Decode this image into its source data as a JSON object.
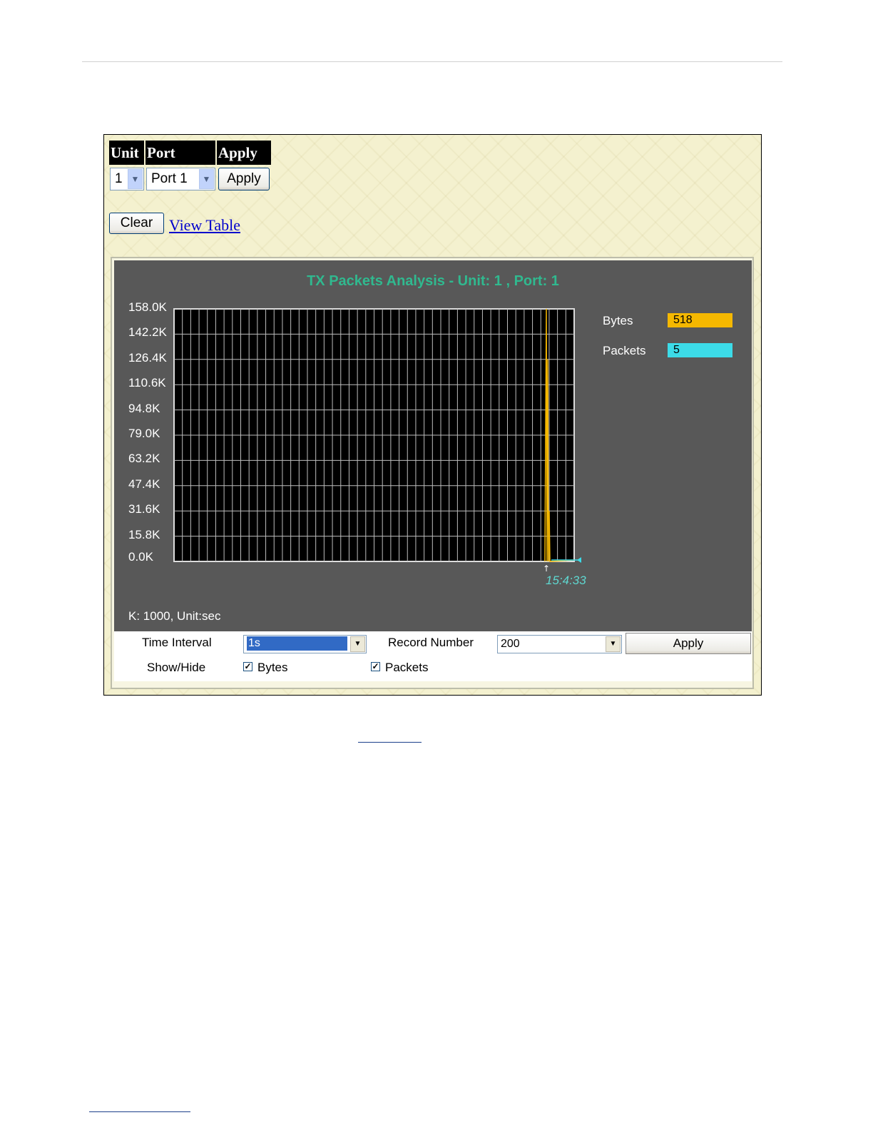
{
  "selector": {
    "unit_header": "Unit",
    "port_header": "Port",
    "apply_header": "Apply",
    "unit_value": "1",
    "port_value": "Port 1",
    "apply_label": "Apply"
  },
  "actions": {
    "clear_label": "Clear",
    "view_table_label": "View Table"
  },
  "chart": {
    "title": "TX Packets Analysis - Unit: 1 , Port: 1",
    "scale_note": "K: 1000, Unit:sec",
    "time_label": "15:4:33",
    "legend": [
      {
        "name": "Bytes",
        "value": "518",
        "color": "#f5b800"
      },
      {
        "name": "Packets",
        "value": "5",
        "color": "#3cdbe8"
      }
    ]
  },
  "chart_data": {
    "type": "line",
    "title": "TX Packets Analysis - Unit: 1 , Port: 1",
    "ylim": [
      0,
      158000
    ],
    "yticks": [
      "158.0K",
      "142.2K",
      "126.4K",
      "110.6K",
      "94.8K",
      "79.0K",
      "63.2K",
      "47.4K",
      "31.6K",
      "15.8K",
      "0.0K"
    ],
    "grid": true,
    "legend": "right",
    "x": [
      "15:4:33"
    ],
    "series": [
      {
        "name": "Bytes",
        "color": "#f5b800",
        "values": [
          158000,
          126400,
          31600,
          518
        ]
      },
      {
        "name": "Packets",
        "color": "#3cdbe8",
        "values": [
          0,
          0,
          0,
          5
        ]
      }
    ]
  },
  "controls": {
    "time_interval_label": "Time Interval",
    "time_interval_value": "1s",
    "record_number_label": "Record Number",
    "record_number_value": "200",
    "apply_label": "Apply",
    "show_hide_label": "Show/Hide",
    "bytes_label": "Bytes",
    "packets_label": "Packets"
  }
}
